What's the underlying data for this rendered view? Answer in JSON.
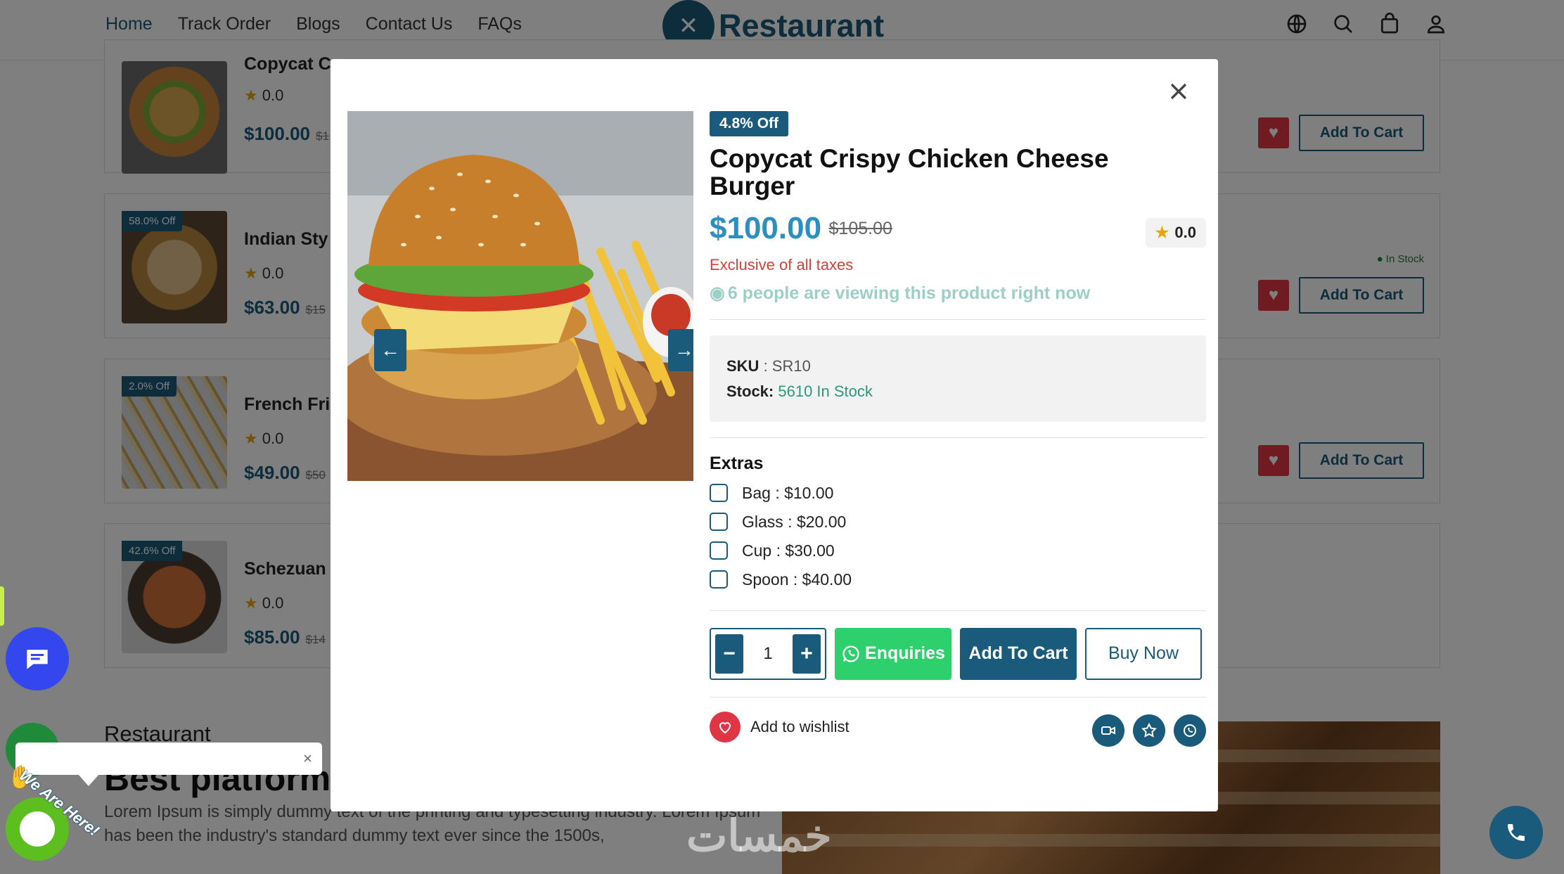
{
  "nav": {
    "links": [
      "Home",
      "Track Order",
      "Blogs",
      "Contact Us",
      "FAQs"
    ],
    "brand": "Restaurant",
    "icons": [
      "globe-icon",
      "search-icon",
      "bag-icon",
      "user-icon"
    ]
  },
  "products": [
    {
      "name": "Copycat C",
      "rating": "0.0",
      "price": "$100.00",
      "old_price": "$1",
      "badge": "",
      "stock": ""
    },
    {
      "name": "Indian Sty",
      "rating": "0.0",
      "price": "$63.00",
      "old_price": "$15",
      "badge": "58.0% Off",
      "stock": "● In Stock"
    },
    {
      "name": "French Fri",
      "rating": "0.0",
      "price": "$49.00",
      "old_price": "$50",
      "badge": "2.0% Off",
      "stock": ""
    },
    {
      "name": "Schezuan",
      "rating": "0.0",
      "price": "$85.00",
      "old_price": "$14",
      "badge": "42.6% Off",
      "stock": ""
    }
  ],
  "product_card_actions": {
    "add_to_cart": "Add To Cart"
  },
  "about": {
    "label": "Restaurant",
    "title": "Best platform",
    "text": "Lorem Ipsum is simply dummy text of the printing and typesetting industry. Lorem Ipsum has been the industry's standard dummy text ever since the 1500s,"
  },
  "widgets": {
    "tawk_label": "We Are Here!",
    "close": "×",
    "watermark": "خمسات"
  },
  "modal": {
    "discount": "4.8% Off",
    "title": "Copycat Crispy Chicken Cheese Burger",
    "price": "$100.00",
    "old_price": "$105.00",
    "rating": "0.0",
    "tax_note": "Exclusive of all taxes",
    "viewers": "6 people are viewing this product right now",
    "sku_label": "SKU",
    "sku_value": " : SR10",
    "stock_label": "Stock:",
    "stock_value": " 5610 In Stock",
    "extras_title": "Extras",
    "extras": [
      "Bag : $10.00",
      "Glass : $20.00",
      "Cup : $30.00",
      "Spoon : $40.00"
    ],
    "quantity": "1",
    "qty_minus": "−",
    "qty_plus": "+",
    "enquiries": "Enquiries",
    "add_to_cart": "Add To Cart",
    "buy_now": "Buy Now",
    "wishlist": "Add to wishlist",
    "share_icons": [
      "video-icon",
      "star-icon",
      "whatsapp-icon"
    ]
  },
  "colors": {
    "primary": "#1a5a7a",
    "accent": "#2c8fbe",
    "danger": "#e03545",
    "whatsapp": "#2ed06e"
  }
}
